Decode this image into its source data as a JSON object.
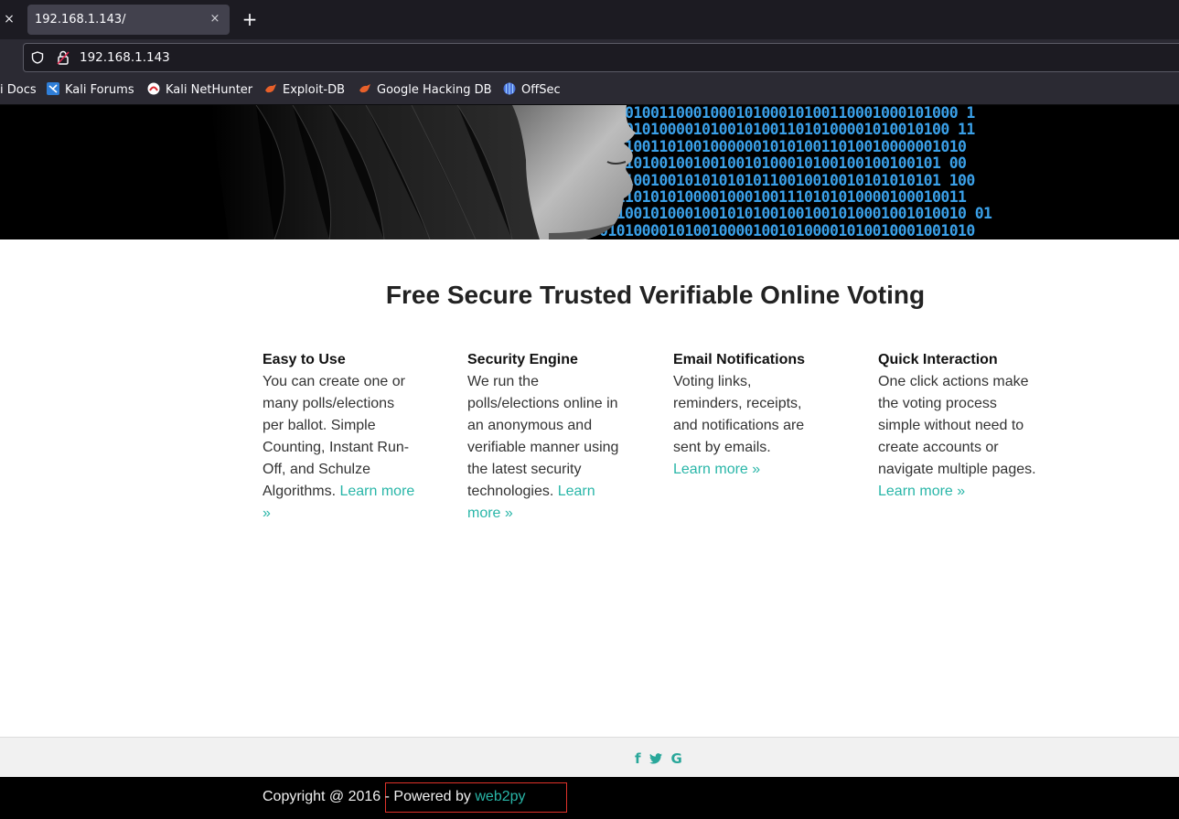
{
  "browser": {
    "tab_title": "192.168.1.143/",
    "tab_close_glyph": "×",
    "new_tab_glyph": "+",
    "url": "192.168.1.143",
    "bookmarks": [
      "i Docs",
      "Kali Forums",
      "Kali NetHunter",
      "Exploit-DB",
      "Google Hacking DB",
      "OffSec"
    ]
  },
  "hero": {
    "binary_lines": [
      "001010011000100010100010100110001000101000 1",
      "11101010000101001010011010100001010010100 11",
      "0101001101001000000101010011010010000001010",
      "0001010010010010010100010100100100100101 00",
      "1001001001010101010110010010010101010101 100",
      "0111010101000010001001110101010000100010011",
      "0010010100010010101001001001010001001010010 01",
      "01010000101001000010010100001010010001001010"
    ]
  },
  "page": {
    "title": "Free Secure Trusted Verifiable Online Voting",
    "features": [
      {
        "heading": "Easy to Use",
        "text": "You can create one or many polls/elections per ballot. Simple Counting, Instant Run-Off, and Schulze Algorithms.",
        "link": "Learn more »"
      },
      {
        "heading": "Security Engine",
        "text": "We run the polls/elections online in an anonymous and verifiable manner using the latest security technologies.",
        "link": "Learn more »"
      },
      {
        "heading": "Email Notifications",
        "text": "Voting links, reminders, receipts, and notifications are sent by emails.",
        "link": "Learn more »"
      },
      {
        "heading": "Quick Interaction",
        "text": "One click actions make the voting process simple without need to create accounts or navigate multiple pages.",
        "link": "Learn more »"
      }
    ]
  },
  "social": {
    "icons": [
      "facebook-icon",
      "twitter-icon",
      "google-icon"
    ],
    "glyphs": [
      "f",
      "🐦",
      "G"
    ],
    "color": "#29a79a"
  },
  "footer": {
    "copyright": "Copyright @ 2016 - Powered by ",
    "link": "web2py",
    "link_color": "#29b6a8"
  }
}
